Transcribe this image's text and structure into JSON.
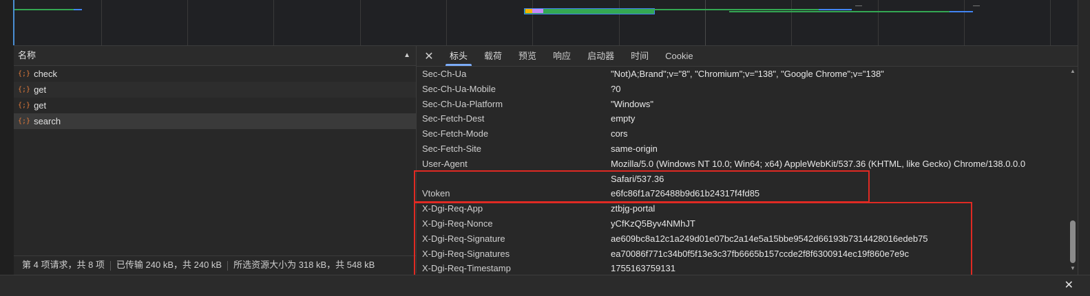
{
  "list": {
    "header": "名称",
    "items": [
      "check",
      "get",
      "get",
      "search"
    ]
  },
  "status": {
    "requests": "第 4 项请求，共 8 项",
    "transferred": "已传输 240 kB，共 240 kB",
    "resources": "所选资源大小为 318 kB，共 548 kB"
  },
  "tabs": [
    "标头",
    "载荷",
    "预览",
    "响应",
    "启动器",
    "时间",
    "Cookie"
  ],
  "headers": [
    {
      "name": "Sec-Ch-Ua",
      "value": "\"Not)A;Brand\";v=\"8\", \"Chromium\";v=\"138\", \"Google Chrome\";v=\"138\""
    },
    {
      "name": "Sec-Ch-Ua-Mobile",
      "value": "?0"
    },
    {
      "name": "Sec-Ch-Ua-Platform",
      "value": "\"Windows\""
    },
    {
      "name": "Sec-Fetch-Dest",
      "value": "empty"
    },
    {
      "name": "Sec-Fetch-Mode",
      "value": "cors"
    },
    {
      "name": "Sec-Fetch-Site",
      "value": "same-origin"
    },
    {
      "name": "User-Agent",
      "value": "Mozilla/5.0 (Windows NT 10.0; Win64; x64) AppleWebKit/537.36 (KHTML, like Gecko) Chrome/138.0.0.0"
    },
    {
      "name": "",
      "value": "Safari/537.36"
    },
    {
      "name": "Vtoken",
      "value": "e6fc86f1a726488b9d61b24317f4fd85"
    },
    {
      "name": "X-Dgi-Req-App",
      "value": "ztbjg-portal"
    },
    {
      "name": "X-Dgi-Req-Nonce",
      "value": "yCfKzQ5Byv4NMhJT"
    },
    {
      "name": "X-Dgi-Req-Signature",
      "value": "ae609bc8a12c1a249d01e07bc2a14e5a15bbe9542d66193b7314428016edeb75"
    },
    {
      "name": "X-Dgi-Req-Signatures",
      "value": "ea70086f771c34b0f5f13e3c37fb6665b157ccde2f8f6300914ec19f860e7e9c"
    },
    {
      "name": "X-Dgi-Req-Timestamp",
      "value": "1755163759131"
    }
  ],
  "colors": {
    "accent": "#7cacf8",
    "highlight_box": "#e02a23",
    "xhr_icon": "#e67c3a"
  }
}
